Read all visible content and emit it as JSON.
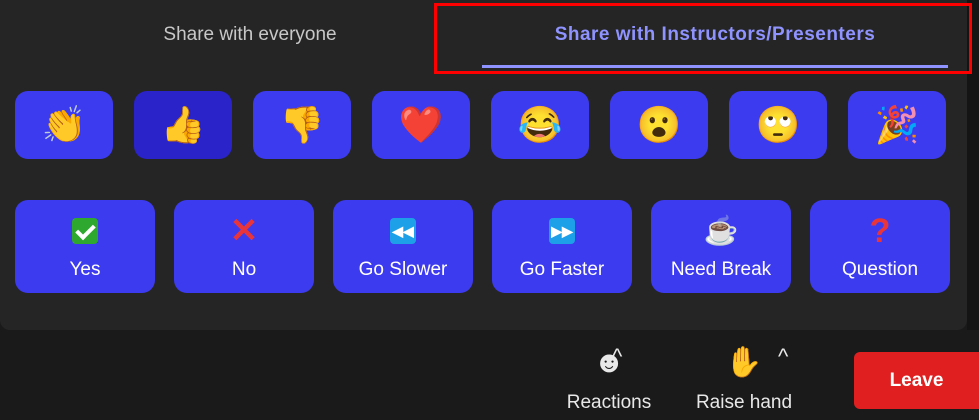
{
  "tabs": {
    "everyone": "Share with everyone",
    "instructors": "Share with Instructors/Presenters"
  },
  "emoji_reactions": [
    {
      "name": "clapping-hands-icon",
      "glyph": "👏"
    },
    {
      "name": "thumbs-up-icon",
      "glyph": "👍",
      "selected": true
    },
    {
      "name": "thumbs-down-icon",
      "glyph": "👎"
    },
    {
      "name": "heart-icon",
      "glyph": "❤️"
    },
    {
      "name": "tears-of-joy-icon",
      "glyph": "😂"
    },
    {
      "name": "surprised-face-icon",
      "glyph": "😮"
    },
    {
      "name": "eye-roll-icon",
      "glyph": "🙄"
    },
    {
      "name": "party-popper-icon",
      "glyph": "🎉"
    }
  ],
  "feedback": {
    "yes": "Yes",
    "no": "No",
    "slower": "Go Slower",
    "faster": "Go Faster",
    "break": "Need Break",
    "question": "Question"
  },
  "icons": {
    "slower_glyph": "◀◀",
    "faster_glyph": "▶▶",
    "coffee_glyph": "☕",
    "x_glyph": "✕",
    "question_glyph": "?",
    "caret_glyph": "^",
    "reactions_glyph": "☻",
    "hand_glyph": "✋"
  },
  "toolbar": {
    "reactions": "Reactions",
    "raise_hand": "Raise hand",
    "leave": "Leave"
  },
  "colors": {
    "accent": "#8f93ff",
    "button": "#3d3bf0",
    "leave": "#e02020"
  }
}
